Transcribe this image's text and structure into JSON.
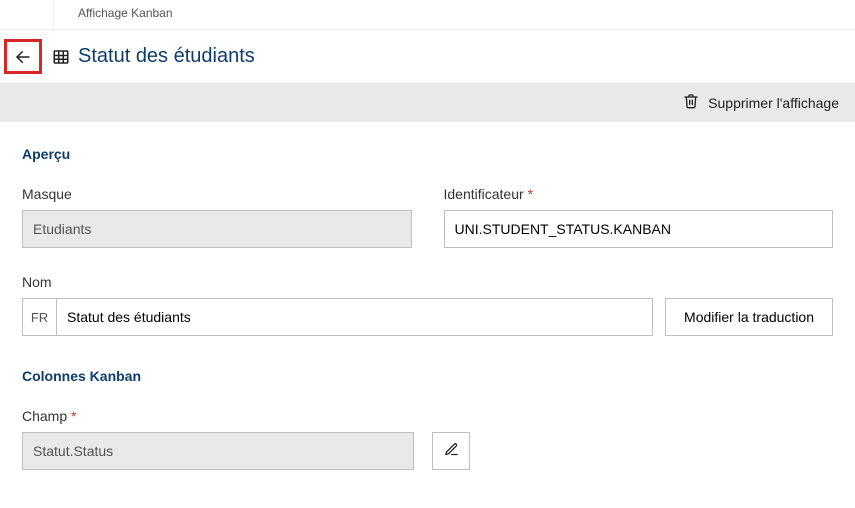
{
  "breadcrumb": {
    "label": "Affichage Kanban"
  },
  "header": {
    "title": "Statut des étudiants"
  },
  "actions": {
    "delete_label": "Supprimer l'affichage"
  },
  "sections": {
    "overview_heading": "Aperçu",
    "kanban_heading": "Colonnes Kanban"
  },
  "fields": {
    "masque": {
      "label": "Masque",
      "value": "Etudiants"
    },
    "identificateur": {
      "label": "Identificateur",
      "value": "UNI.STUDENT_STATUS.KANBAN"
    },
    "nom": {
      "label": "Nom",
      "lang": "FR",
      "value": "Statut des étudiants",
      "translate_button": "Modifier la traduction"
    },
    "champ": {
      "label": "Champ",
      "value": "Statut.Status"
    }
  }
}
